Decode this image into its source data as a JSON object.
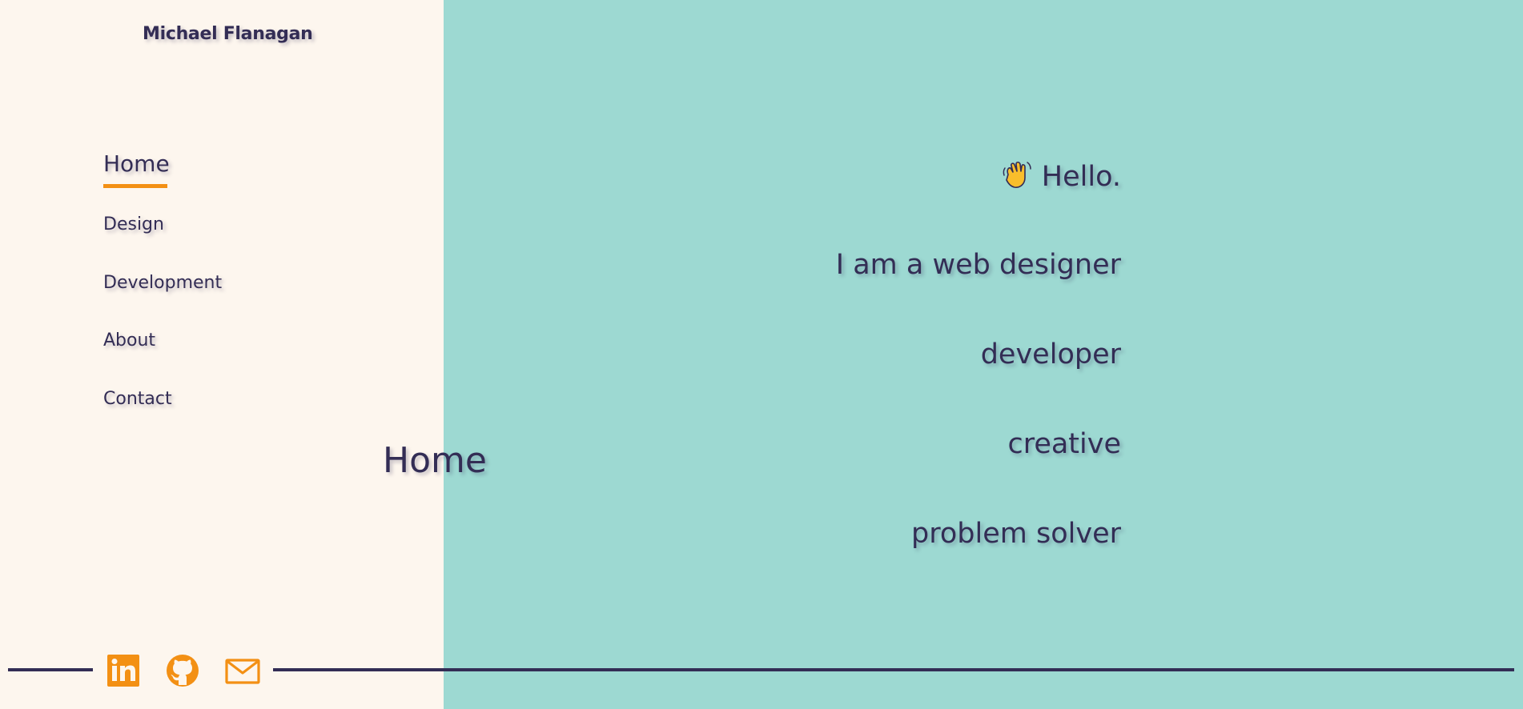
{
  "header": {
    "site_name": "Michael Flanagan"
  },
  "nav": {
    "items": [
      {
        "label": "Home",
        "active": true
      },
      {
        "label": "Design",
        "active": false
      },
      {
        "label": "Development",
        "active": false
      },
      {
        "label": "About",
        "active": false
      },
      {
        "label": "Contact",
        "active": false
      }
    ]
  },
  "main": {
    "page_title": "Home",
    "hero": {
      "greeting": "Hello.",
      "lines": [
        "I am a web designer",
        "developer",
        "creative",
        "problem solver"
      ]
    }
  },
  "social": {
    "icons": [
      "linkedin-icon",
      "github-icon",
      "mail-icon"
    ]
  },
  "colors": {
    "accent": "#f39014",
    "text": "#332d55",
    "left_bg": "#fdf6ee",
    "right_bg": "#9dd9d2"
  }
}
